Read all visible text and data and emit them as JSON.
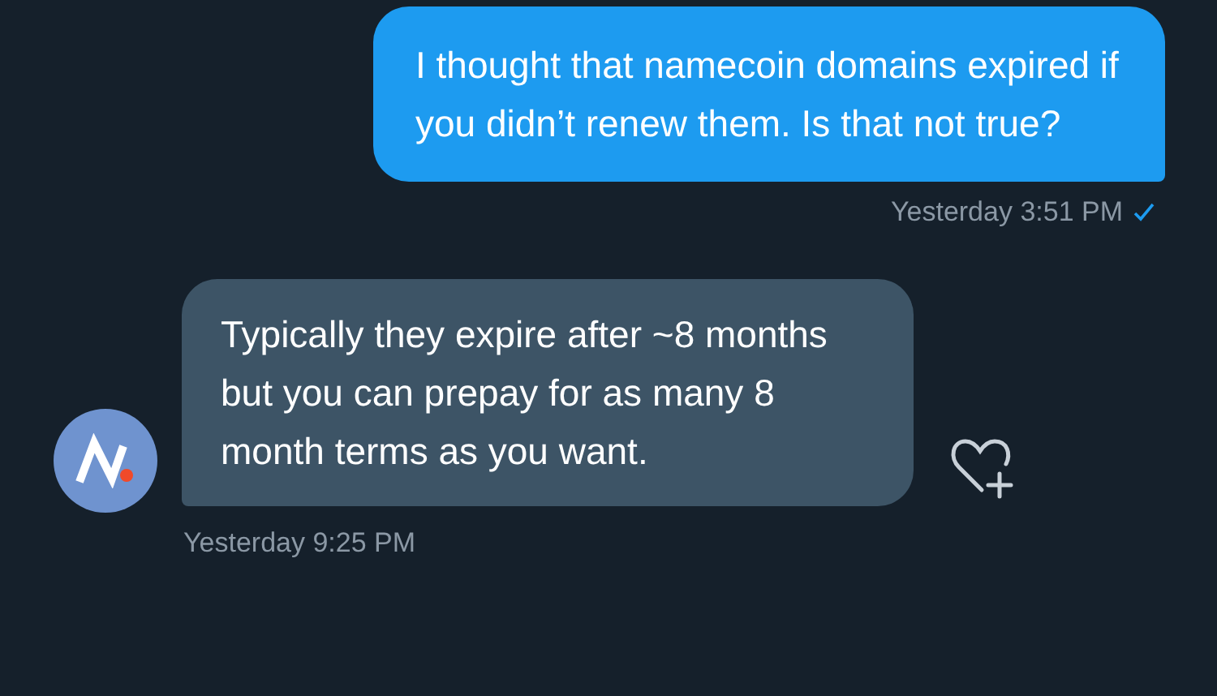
{
  "messages": [
    {
      "kind": "sent",
      "text": "I thought that namecoin domains expired if you didn’t renew them. Is that not true?",
      "time": "Yesterday 3:51 PM",
      "read": true
    },
    {
      "kind": "received",
      "text": "Typically they expire after ~8 months but you can prepay for as many 8 month terms as you want.",
      "time": "Yesterday 9:25 PM"
    }
  ]
}
